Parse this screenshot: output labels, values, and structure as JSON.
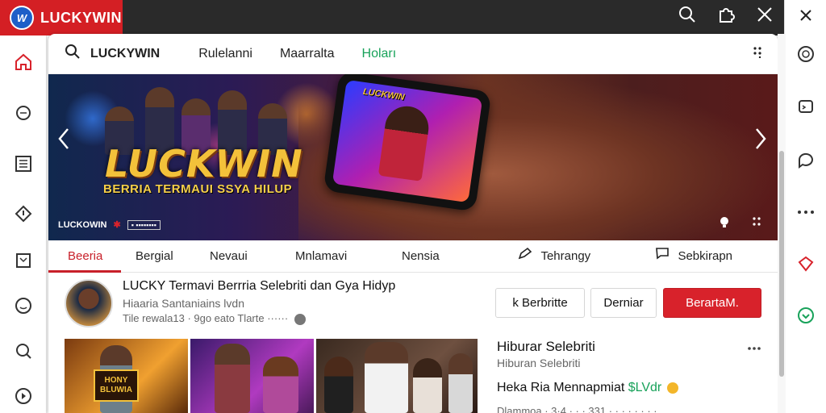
{
  "brand": {
    "name": "LUCKYWIN",
    "logo_text": "W"
  },
  "topbar": {
    "icons": [
      "search-icon",
      "extension-icon",
      "close-icon"
    ]
  },
  "rightrail": {
    "close_icon": "close-icon",
    "icons": [
      "circle-icon",
      "chat-bubble-icon",
      "comment-icon",
      "more-icon",
      "gem-icon",
      "download-icon"
    ]
  },
  "leftrail": {
    "icons": [
      "home-icon",
      "chat-icon",
      "list-icon",
      "info-icon",
      "bookmark-icon",
      "smile-icon",
      "search-icon",
      "play-icon"
    ]
  },
  "navbar": {
    "site": "LUCKYWIN",
    "links": [
      "Rulelanni",
      "Maarralta",
      "Hoları"
    ],
    "active_index": 2
  },
  "hero": {
    "title": "LUCKWIN",
    "subtitle": "BERRIA TERMAUI SSYA HILUP",
    "badge": "LUCKOWIN",
    "badge_chip": "▪ ▪▪▪▪▪▪▪▪"
  },
  "tabs": [
    {
      "label": "Beeria",
      "icon": ""
    },
    {
      "label": "Bergial",
      "icon": ""
    },
    {
      "label": "Nevaui",
      "icon": ""
    },
    {
      "label": "Mnlamavi",
      "icon": ""
    },
    {
      "label": "Nensia",
      "icon": ""
    },
    {
      "label": "Tehrangy",
      "icon": "pen-icon"
    },
    {
      "label": "Sebkirapn",
      "icon": "chat-icon"
    }
  ],
  "post": {
    "title": "LUCKY Termavi Berrria Selebriti dan Gya Hidyp",
    "meta1": "Hiaaria Santaniains lvdn",
    "meta2": "Tile rewala13 · 9go eato Tlarte ······"
  },
  "buttons": {
    "b1": "k Berbritte",
    "b2": "Derniar",
    "b3": "BerartaM."
  },
  "thumbs": {
    "label1": "HONY BLUWIA"
  },
  "side": {
    "title": "Hiburar Selebriti",
    "subtitle": "Hiburan Selebriti",
    "line_text": "Heka Ria Mennapmiat",
    "line_green": "$LVdr",
    "bottom": "Dlammoa · 3·4 · · · 331 · · · · · · · ·"
  },
  "colors": {
    "brand_red": "#d41f24",
    "accent_green": "#18a25a",
    "button_red": "#d8222b"
  }
}
